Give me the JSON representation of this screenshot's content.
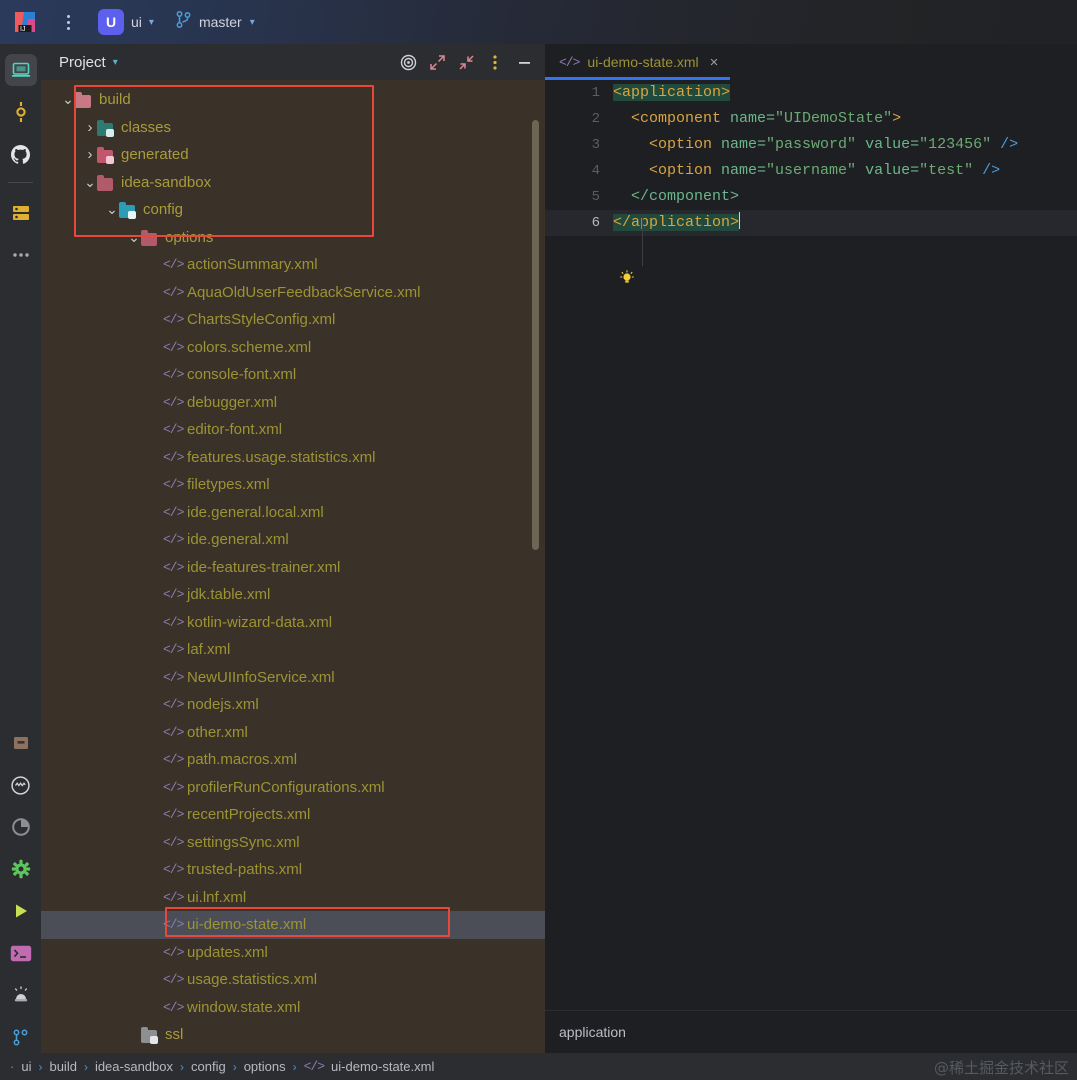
{
  "topbar": {
    "app_icon": "intellij-idea-logo",
    "menu_icon": "main-menu-dots-icon",
    "project_badge": "U",
    "project_name": "ui",
    "project_caret": "chevron-down-icon",
    "vcs_icon": "git-branch-icon",
    "branch_name": "master",
    "branch_caret": "chevron-down-icon"
  },
  "leftbar": {
    "items": [
      {
        "name": "project-tool-window",
        "icon": "laptop-icon",
        "active": true
      },
      {
        "name": "commit-tool-window",
        "icon": "commit-icon",
        "active": false
      },
      {
        "name": "github-tool-window",
        "icon": "github-icon",
        "active": false
      },
      {
        "name": "database-tool-window",
        "icon": "database-icon",
        "active": false
      },
      {
        "name": "more-tool-windows",
        "icon": "more-dots-icon",
        "active": false
      }
    ],
    "bottom_items": [
      {
        "name": "package-tool-window",
        "icon": "package-box-icon"
      },
      {
        "name": "problems-tool-window",
        "icon": "circle-wave-icon"
      },
      {
        "name": "profiler-tool-window",
        "icon": "pie-chart-icon"
      },
      {
        "name": "settings-sync",
        "icon": "green-gear-icon"
      },
      {
        "name": "run-tool-window",
        "icon": "run-play-icon"
      },
      {
        "name": "terminal-tool-window",
        "icon": "terminal-icon"
      },
      {
        "name": "notifications",
        "icon": "alarm-siren-icon"
      },
      {
        "name": "version-control-tool-window",
        "icon": "git-branch-icon"
      }
    ]
  },
  "project_panel": {
    "title": "Project",
    "title_caret": "chevron-down-icon",
    "toolbar": [
      {
        "name": "select-opened-file-button",
        "icon": "target-icon"
      },
      {
        "name": "expand-all-button",
        "icon": "expand-arrows-icon"
      },
      {
        "name": "collapse-all-button",
        "icon": "collapse-arrows-icon"
      },
      {
        "name": "options-button",
        "icon": "vertical-dots-icon"
      },
      {
        "name": "hide-button",
        "icon": "minimize-dash-icon"
      }
    ],
    "tree": [
      {
        "label": "build",
        "indent": 0,
        "arrow": "v",
        "icon": "folder-salmon",
        "type": "folder",
        "selected": false
      },
      {
        "label": "classes",
        "indent": 1,
        "arrow": ">",
        "icon": "folder-teal",
        "type": "folder",
        "selected": false
      },
      {
        "label": "generated",
        "indent": 1,
        "arrow": ">",
        "icon": "folder-pink2",
        "type": "folder",
        "selected": false
      },
      {
        "label": "idea-sandbox",
        "indent": 1,
        "arrow": "v",
        "icon": "folder-pink",
        "type": "folder",
        "selected": false
      },
      {
        "label": "config",
        "indent": 2,
        "arrow": "v",
        "icon": "folder-cyan",
        "type": "folder",
        "selected": false
      },
      {
        "label": "options",
        "indent": 3,
        "arrow": "v",
        "icon": "folder-pink",
        "type": "folder",
        "selected": false
      },
      {
        "label": "actionSummary.xml",
        "indent": 4,
        "arrow": "",
        "icon": "xml-file",
        "type": "file",
        "selected": false
      },
      {
        "label": "AquaOldUserFeedbackService.xml",
        "indent": 4,
        "arrow": "",
        "icon": "xml-file",
        "type": "file",
        "selected": false
      },
      {
        "label": "ChartsStyleConfig.xml",
        "indent": 4,
        "arrow": "",
        "icon": "xml-file",
        "type": "file",
        "selected": false
      },
      {
        "label": "colors.scheme.xml",
        "indent": 4,
        "arrow": "",
        "icon": "xml-file",
        "type": "file",
        "selected": false
      },
      {
        "label": "console-font.xml",
        "indent": 4,
        "arrow": "",
        "icon": "xml-file",
        "type": "file",
        "selected": false
      },
      {
        "label": "debugger.xml",
        "indent": 4,
        "arrow": "",
        "icon": "xml-file",
        "type": "file",
        "selected": false
      },
      {
        "label": "editor-font.xml",
        "indent": 4,
        "arrow": "",
        "icon": "xml-file",
        "type": "file",
        "selected": false
      },
      {
        "label": "features.usage.statistics.xml",
        "indent": 4,
        "arrow": "",
        "icon": "xml-file",
        "type": "file",
        "selected": false
      },
      {
        "label": "filetypes.xml",
        "indent": 4,
        "arrow": "",
        "icon": "xml-file",
        "type": "file",
        "selected": false
      },
      {
        "label": "ide.general.local.xml",
        "indent": 4,
        "arrow": "",
        "icon": "xml-file",
        "type": "file",
        "selected": false
      },
      {
        "label": "ide.general.xml",
        "indent": 4,
        "arrow": "",
        "icon": "xml-file",
        "type": "file",
        "selected": false
      },
      {
        "label": "ide-features-trainer.xml",
        "indent": 4,
        "arrow": "",
        "icon": "xml-file",
        "type": "file",
        "selected": false
      },
      {
        "label": "jdk.table.xml",
        "indent": 4,
        "arrow": "",
        "icon": "xml-file",
        "type": "file",
        "selected": false
      },
      {
        "label": "kotlin-wizard-data.xml",
        "indent": 4,
        "arrow": "",
        "icon": "xml-file",
        "type": "file",
        "selected": false
      },
      {
        "label": "laf.xml",
        "indent": 4,
        "arrow": "",
        "icon": "xml-file",
        "type": "file",
        "selected": false
      },
      {
        "label": "NewUIInfoService.xml",
        "indent": 4,
        "arrow": "",
        "icon": "xml-file",
        "type": "file",
        "selected": false
      },
      {
        "label": "nodejs.xml",
        "indent": 4,
        "arrow": "",
        "icon": "xml-file",
        "type": "file",
        "selected": false
      },
      {
        "label": "other.xml",
        "indent": 4,
        "arrow": "",
        "icon": "xml-file",
        "type": "file",
        "selected": false
      },
      {
        "label": "path.macros.xml",
        "indent": 4,
        "arrow": "",
        "icon": "xml-file",
        "type": "file",
        "selected": false
      },
      {
        "label": "profilerRunConfigurations.xml",
        "indent": 4,
        "arrow": "",
        "icon": "xml-file",
        "type": "file",
        "selected": false
      },
      {
        "label": "recentProjects.xml",
        "indent": 4,
        "arrow": "",
        "icon": "xml-file",
        "type": "file",
        "selected": false
      },
      {
        "label": "settingsSync.xml",
        "indent": 4,
        "arrow": "",
        "icon": "xml-file",
        "type": "file",
        "selected": false
      },
      {
        "label": "trusted-paths.xml",
        "indent": 4,
        "arrow": "",
        "icon": "xml-file",
        "type": "file",
        "selected": false
      },
      {
        "label": "ui.lnf.xml",
        "indent": 4,
        "arrow": "",
        "icon": "xml-file",
        "type": "file",
        "selected": false
      },
      {
        "label": "ui-demo-state.xml",
        "indent": 4,
        "arrow": "",
        "icon": "xml-file",
        "type": "file",
        "selected": true
      },
      {
        "label": "updates.xml",
        "indent": 4,
        "arrow": "",
        "icon": "xml-file",
        "type": "file",
        "selected": false
      },
      {
        "label": "usage.statistics.xml",
        "indent": 4,
        "arrow": "",
        "icon": "xml-file",
        "type": "file",
        "selected": false
      },
      {
        "label": "window.state.xml",
        "indent": 4,
        "arrow": "",
        "icon": "xml-file",
        "type": "file",
        "selected": false
      },
      {
        "label": "ssl",
        "indent": 3,
        "arrow": "",
        "icon": "folder-gray",
        "type": "folder",
        "selected": false
      }
    ],
    "annotations": {
      "folder_highlight": "red-rectangle-around-build-through-options",
      "file_highlight": "red-rectangle-around-ui-demo-state-xml"
    }
  },
  "editor": {
    "tab": {
      "icon": "xml-file-icon",
      "label": "ui-demo-state.xml",
      "close": "×"
    },
    "lines": [
      {
        "num": "1",
        "current": false
      },
      {
        "num": "2",
        "current": false
      },
      {
        "num": "3",
        "current": false
      },
      {
        "num": "4",
        "current": false
      },
      {
        "num": "5",
        "current": false
      },
      {
        "num": "6",
        "current": true
      }
    ],
    "code": {
      "l1_tag": "<application>",
      "l2": "  <component name=\"UIDemoState\">",
      "l3": "    <option name=\"password\" value=\"123456\" />",
      "l4": "    <option name=\"username\" value=\"test\" />",
      "l5": "  </component>",
      "l6_tag": "</application>"
    },
    "code_tokens": {
      "l2_open": "  <component",
      "l2_attr": " name=",
      "l2_val": "\"UIDemoState\"",
      "l2_close": ">",
      "l3_open": "    <option",
      "l3_attr1": " name=",
      "l3_val1": "\"password\"",
      "l3_attr2": " value=",
      "l3_val2": "\"123456\"",
      "l3_end": " />",
      "l4_open": "    <option",
      "l4_attr1": " name=",
      "l4_val1": "\"username\"",
      "l4_attr2": " value=",
      "l4_val2": "\"test\"",
      "l4_end": " />",
      "l5_text": "  </component>"
    },
    "inspection_icon": "lightbulb-icon",
    "status_text": "application"
  },
  "statusbar": {
    "breadcrumb": [
      "ui",
      "build",
      "idea-sandbox",
      "config",
      "options",
      "ui-demo-state.xml"
    ],
    "separator": "›",
    "leading_dot": "·",
    "file_icon": "xml-file-icon",
    "watermark": "@稀土掘金技术社区"
  },
  "colors": {
    "accent_blue": "#3574f0",
    "highlight_red": "#e8483c",
    "tree_bg": "#3a3129",
    "editor_bg": "#1e1f22",
    "file_text": "#9c9334",
    "selection": "#4b4e57"
  }
}
